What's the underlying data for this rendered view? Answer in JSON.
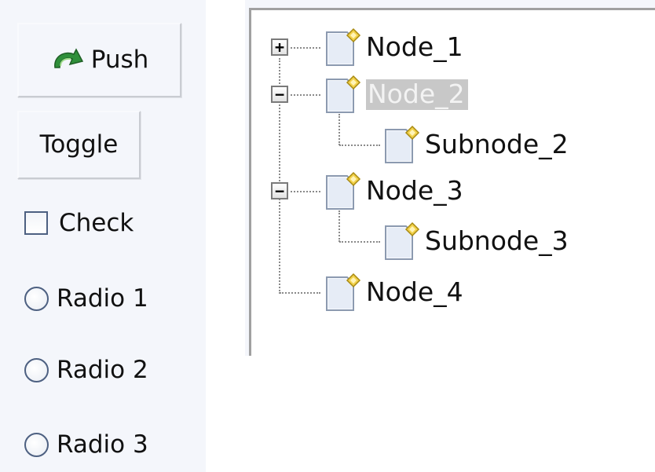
{
  "controls": {
    "push_button": {
      "label": "Push",
      "icon": "green-arrow-icon"
    },
    "toggle_button": {
      "label": "Toggle"
    },
    "checkbox": {
      "label": "Check",
      "checked": false
    },
    "radios": [
      {
        "label": "Radio 1",
        "selected": false
      },
      {
        "label": "Radio 2",
        "selected": false
      },
      {
        "label": "Radio 3",
        "selected": false
      }
    ]
  },
  "tree": {
    "nodes": [
      {
        "label": "Node_1",
        "expander": "+",
        "selected": false
      },
      {
        "label": "Node_2",
        "expander": "−",
        "selected": true
      },
      {
        "label": "Subnode_2"
      },
      {
        "label": "Node_3",
        "expander": "−",
        "selected": false
      },
      {
        "label": "Subnode_3"
      },
      {
        "label": "Node_4"
      }
    ],
    "selection_color": "#c8c8c8",
    "icon": "document-icon"
  }
}
